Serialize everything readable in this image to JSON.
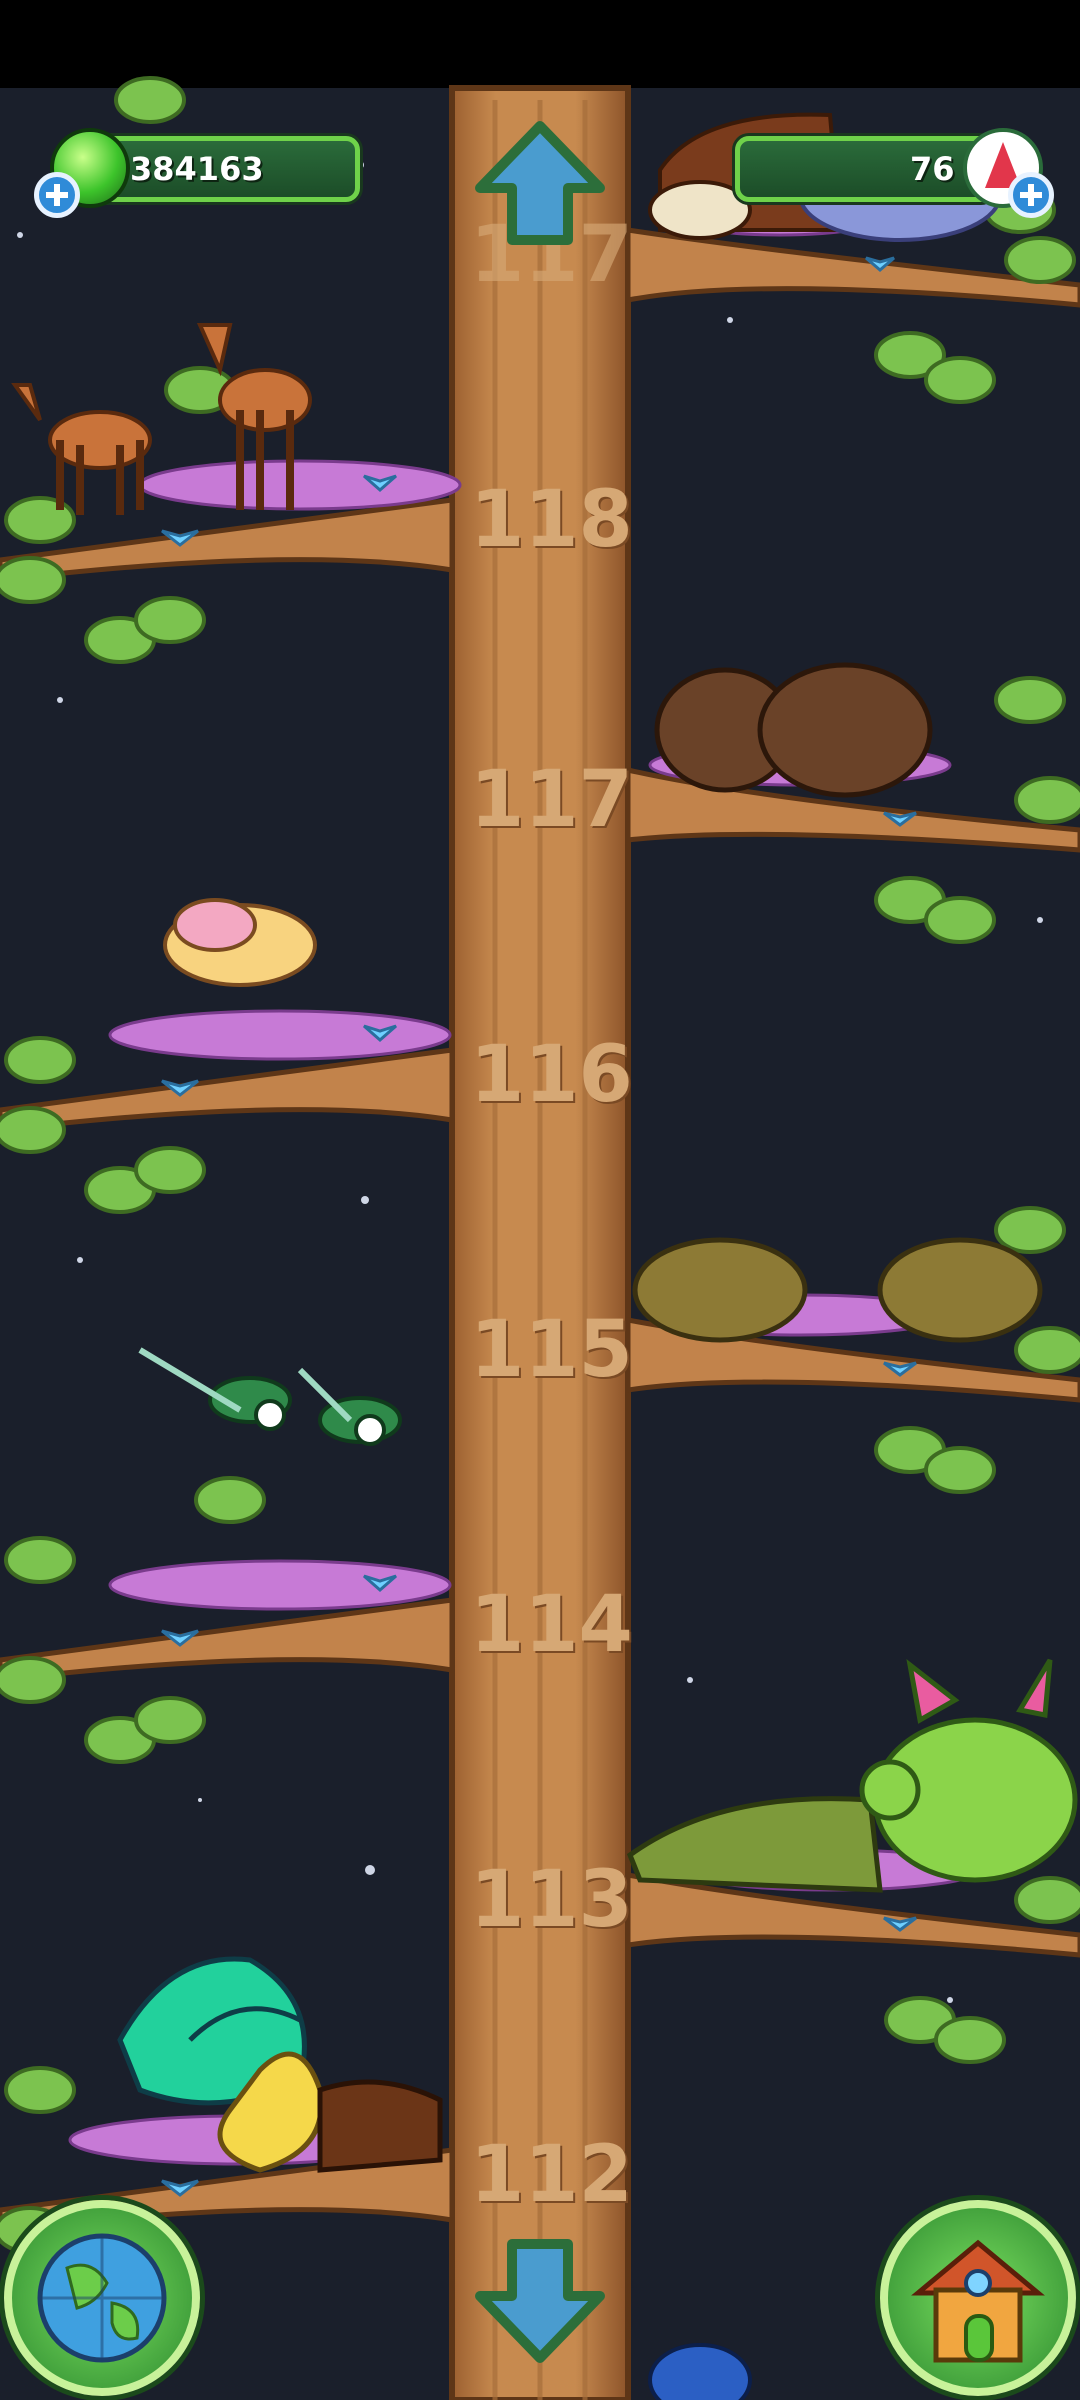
{
  "hud": {
    "food_amount": "384163",
    "gems_amount": "76",
    "food_icon": "green-gem-icon",
    "gem_icon": "red-crystal-icon"
  },
  "levels": [
    {
      "number": "118",
      "side": "left",
      "animals": "deer"
    },
    {
      "number": "117",
      "side": "right",
      "animals": "wombat"
    },
    {
      "number": "116",
      "side": "left",
      "animals": "pink-bunny"
    },
    {
      "number": "115",
      "side": "right",
      "animals": "armadillo"
    },
    {
      "number": "114",
      "side": "left",
      "animals": "dragonfly"
    },
    {
      "number": "113",
      "side": "right",
      "animals": "crocodile-and-green-monster"
    },
    {
      "number": "112",
      "side": "left",
      "animals": "butterfly-seahorse-dog"
    }
  ],
  "partial_top_level": "117",
  "colors": {
    "background": "#1a1f2b",
    "trunk": "#c2834b",
    "leaf": "#7cc34f",
    "moss": "#c77ad6",
    "hud_border": "#6fd24a"
  },
  "icons": {
    "up_arrow": "arrow-up-icon",
    "down_arrow": "arrow-down-icon",
    "map": "globe-icon",
    "home": "house-icon"
  }
}
